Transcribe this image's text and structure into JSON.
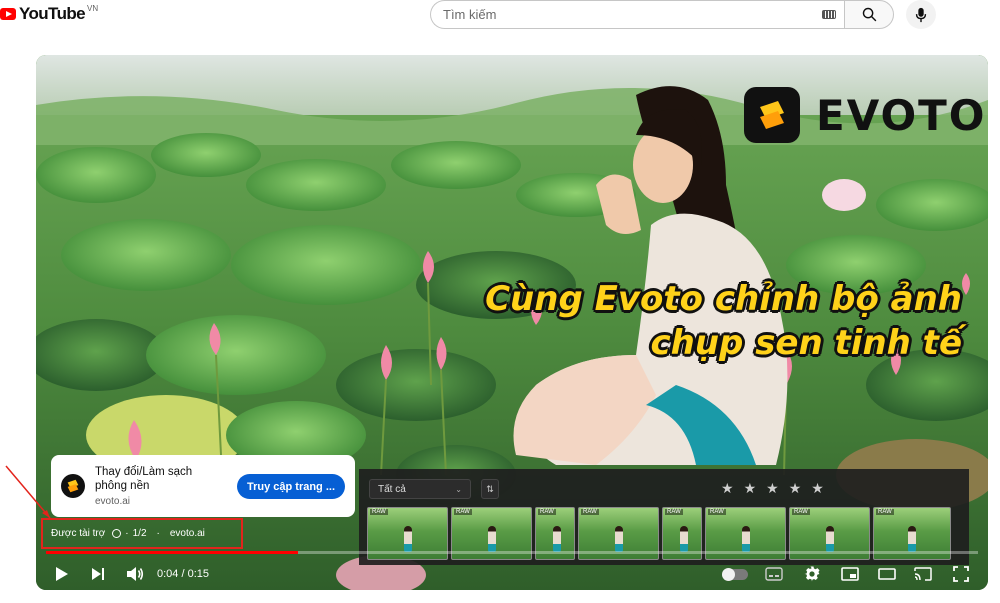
{
  "header": {
    "logo_text": "YouTube",
    "logo_country": "VN",
    "search_placeholder": "Tìm kiếm"
  },
  "video": {
    "brand_name": "EVOTO",
    "headline_line1": "Cùng Evoto chỉnh bộ ảnh",
    "headline_line2": "chụp sen tinh tế"
  },
  "ad": {
    "card_title": "Thay đổi/Làm sạch phông nền",
    "card_domain": "evoto.ai",
    "cta_label": "Truy cập trang ...",
    "sponsored_label": "Được tài trợ",
    "ad_count": "1/2",
    "sponsor_domain": "evoto.ai"
  },
  "app_panel": {
    "filter_label": "Tất cả",
    "raw_badge": "RAW",
    "thumbnail_count": 8,
    "rating_stars": 5
  },
  "player": {
    "time_current": "0:04",
    "time_separator": "/",
    "time_total": "0:15",
    "progress_fraction": 0.27
  },
  "colors": {
    "accent_red": "#ff0000",
    "cta_blue": "#065fd4",
    "headline_yellow": "#ffd21a",
    "highlight_box": "#e3241c"
  }
}
